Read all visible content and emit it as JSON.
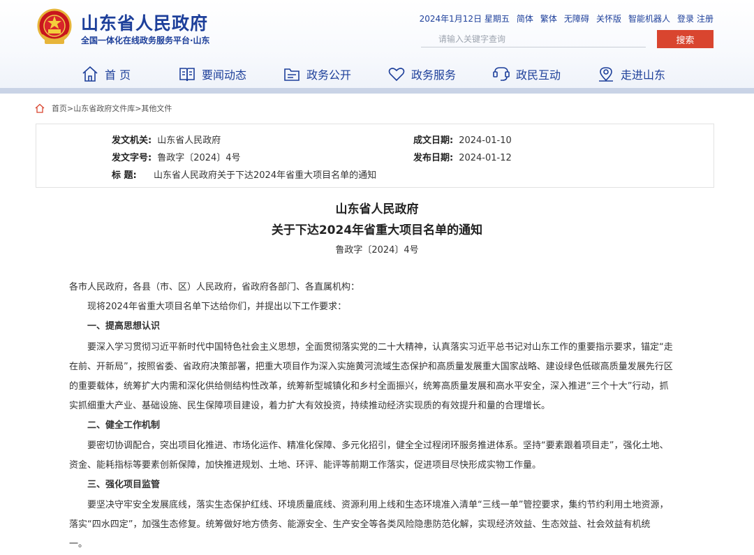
{
  "site": {
    "title": "山东省人民政府",
    "subtitle": "全国一体化在线政务服务平台·山东"
  },
  "top_links": {
    "date": "2024年1月12日 星期五",
    "simplified": "简体",
    "traditional": "繁体",
    "accessible": "无障碍",
    "care": "关怀版",
    "robot": "智能机器人",
    "login": "登录",
    "register": "注册"
  },
  "search": {
    "placeholder": "请输入关键字查询",
    "button": "搜索"
  },
  "nav": {
    "items": [
      {
        "label": "首 页",
        "icon": "home-icon"
      },
      {
        "label": "要闻动态",
        "icon": "book-icon"
      },
      {
        "label": "政务公开",
        "icon": "folder-icon"
      },
      {
        "label": "政务服务",
        "icon": "heart-icon"
      },
      {
        "label": "政民互动",
        "icon": "chat-icon"
      },
      {
        "label": "走进山东",
        "icon": "location-icon"
      }
    ]
  },
  "breadcrumb": "首页>山东省政府文件库>其他文件",
  "info": {
    "issuer_label": "发文机关:",
    "issuer": "山东省人民政府",
    "created_label": "成文日期:",
    "created": "2024-01-10",
    "number_label": "发文字号:",
    "number": "鲁政字〔2024〕4号",
    "published_label": "发布日期:",
    "published": "2024-01-12",
    "title_label": "标 题:",
    "title": "山东省人民政府关于下达2024年省重大项目名单的通知"
  },
  "article": {
    "title_line1": "山东省人民政府",
    "title_line2": "关于下达2024年省重大项目名单的通知",
    "doc_no": "鲁政字〔2024〕4号",
    "lines": [
      "各市人民政府，各县（市、区）人民政府，省政府各部门、各直属机构：",
      "　　现将2024年省重大项目名单下达给你们，并提出以下工作要求：",
      "　　一、提高思想认识",
      "　　要深入学习贯彻习近平新时代中国特色社会主义思想，全面贯彻落实党的二十大精神，认真落实习近平总书记对山东工作的重要指示要求，锚定“走",
      "在前、开新局”，按照省委、省政府决策部署，把重大项目作为深入实施黄河流域生态保护和高质量发展重大国家战略、建设绿色低碳高质量发展先行区",
      "的重要载体，统筹扩大内需和深化供给侧结构性改革，统筹新型城镇化和乡村全面振兴，统筹高质量发展和高水平安全，深入推进“三个十大”行动，抓",
      "实抓细重大产业、基础设施、民生保障项目建设，着力扩大有效投资，持续推动经济实现质的有效提升和量的合理增长。",
      "　　二、健全工作机制",
      "　　要密切协调配合，突出项目化推进、市场化运作、精准化保障、多元化招引，健全全过程闭环服务推进体系。坚持“要素跟着项目走”，强化土地、",
      "资金、能耗指标等要素创新保障，加快推进规划、土地、环评、能评等前期工作落实，促进项目尽快形成实物工作量。",
      "　　三、强化项目监管",
      "　　要坚决守牢安全发展底线，落实生态保护红线、环境质量底线、资源利用上线和生态环境准入清单“三线一单”管控要求，集约节约利用土地资源，",
      "落实“四水四定”，加强生态修复。统筹做好地方债务、能源安全、生产安全等各类风险隐患防范化解，实现经济效益、生态效益、社会效益有机统",
      "一。"
    ]
  },
  "colors": {
    "brand": "#1d3f9a",
    "search_button": "#d9452f",
    "header_bar": "#c9d3e6"
  }
}
